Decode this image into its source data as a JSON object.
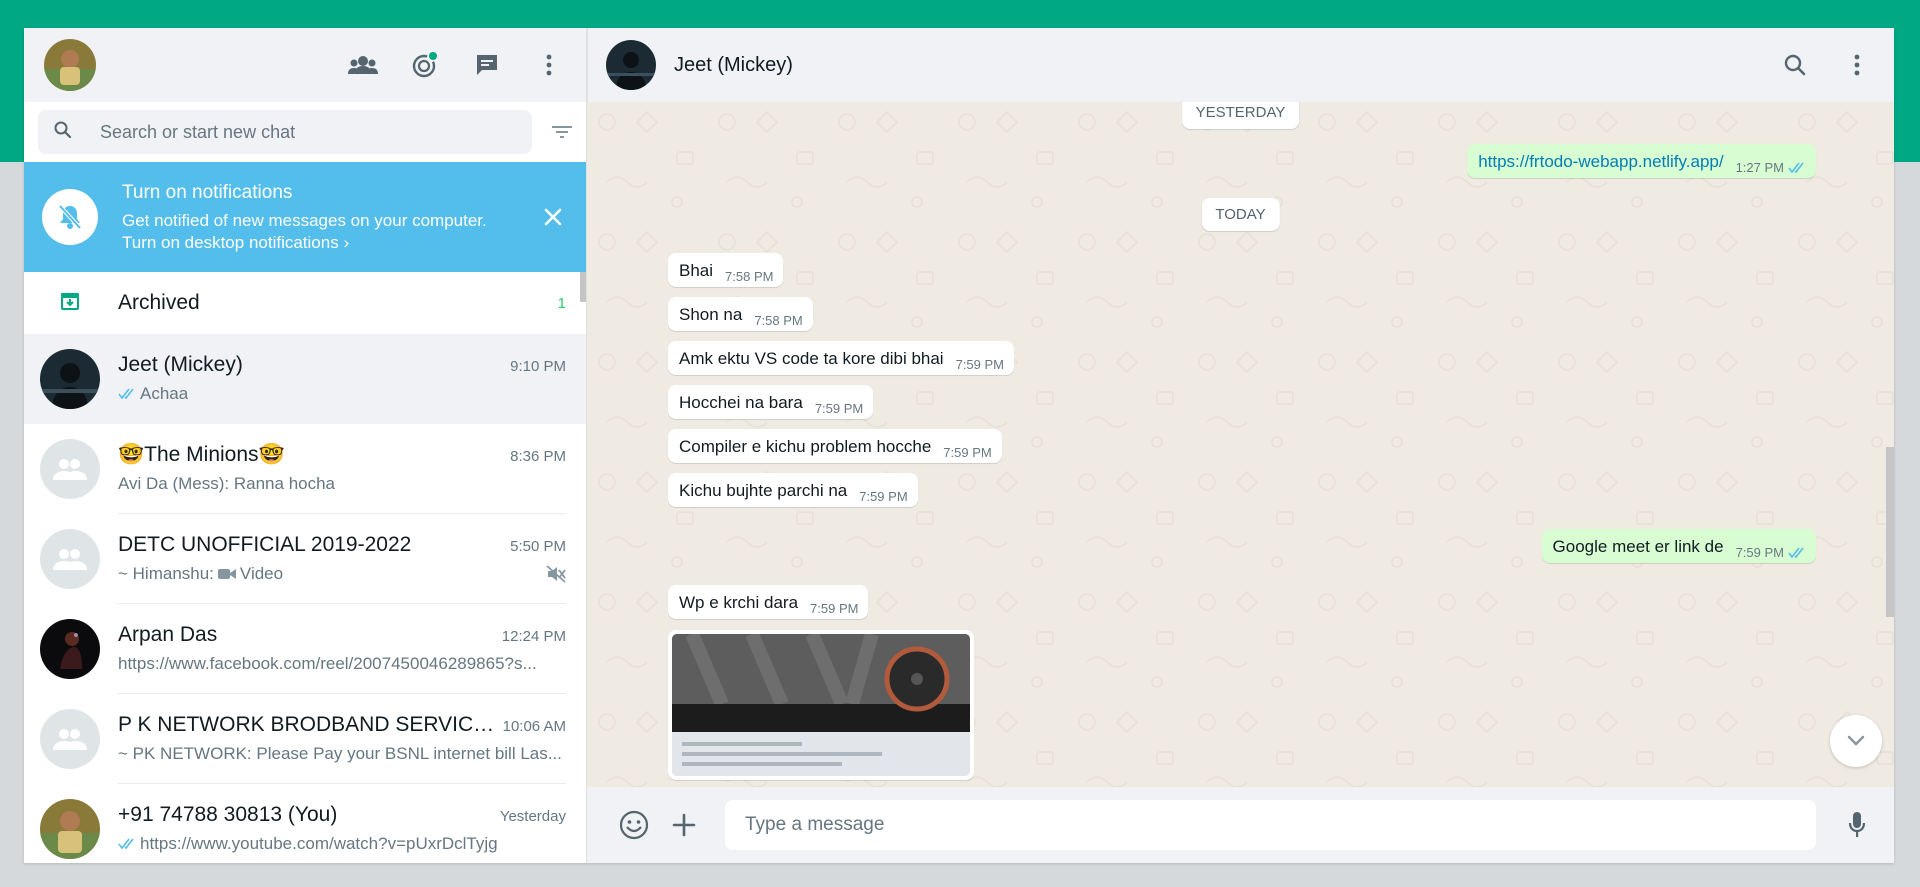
{
  "colors": {
    "teal": "#00a884",
    "notif_bg": "#53bdeb",
    "out_bubble": "#d9fdd3",
    "tick_blue": "#53bdeb",
    "unread_green": "#25d366"
  },
  "sidebar": {
    "icons": [
      "community-icon",
      "status-icon",
      "new-chat-icon",
      "menu-icon"
    ],
    "search_placeholder": "Search or start new chat",
    "notification": {
      "title": "Turn on notifications",
      "subtitle": "Get notified of new messages on your computer.",
      "link": "Turn on desktop notifications"
    },
    "archived": {
      "label": "Archived",
      "count": "1"
    },
    "chats": [
      {
        "name": "Jeet (Mickey)",
        "time": "9:10 PM",
        "preview": "Achaa",
        "ticks": true
      },
      {
        "name": "🤓The Minions🤓",
        "time": "8:36 PM",
        "preview": "Avi Da (Mess): Ranna hocha"
      },
      {
        "name": "DETC UNOFFICIAL 2019-2022",
        "time": "5:50 PM",
        "preview_prefix": "~ Himanshu: ",
        "preview": "Video",
        "muted": true
      },
      {
        "name": "Arpan Das",
        "time": "12:24 PM",
        "preview": "https://www.facebook.com/reel/2007450046289865?s..."
      },
      {
        "name": "P K NETWORK BRODBAND SERVICE ...",
        "time": "10:06 AM",
        "preview": "~ PK NETWORK: Please Pay your BSNL internet bill Las..."
      },
      {
        "name": "+91 74788 30813 (You)",
        "time": "Yesterday",
        "preview": "https://www.youtube.com/watch?v=pUxrDclTyjg",
        "ticks": true
      }
    ]
  },
  "conversation": {
    "contact_name": "Jeet (Mickey)",
    "date_yesterday": "YESTERDAY",
    "date_today": "TODAY",
    "messages": [
      {
        "dir": "out",
        "text": "https://frtodo-webapp.netlify.app/",
        "time": "1:27 PM",
        "link": true
      },
      {
        "dir": "in",
        "text": "Bhai",
        "time": "7:58 PM"
      },
      {
        "dir": "in",
        "text": "Shon na",
        "time": "7:58 PM"
      },
      {
        "dir": "in",
        "text": "Amk ektu VS code ta kore dibi bhai",
        "time": "7:59 PM"
      },
      {
        "dir": "in",
        "text": "Hocchei na bara",
        "time": "7:59 PM"
      },
      {
        "dir": "in",
        "text": "Compiler e kichu problem hocche",
        "time": "7:59 PM"
      },
      {
        "dir": "in",
        "text": "Kichu bujhte parchi na",
        "time": "7:59 PM"
      },
      {
        "dir": "out",
        "text": "Google meet er link de",
        "time": "7:59 PM"
      },
      {
        "dir": "in",
        "text": "Wp e krchi dara",
        "time": "7:59 PM"
      }
    ],
    "composer_placeholder": "Type a message"
  }
}
